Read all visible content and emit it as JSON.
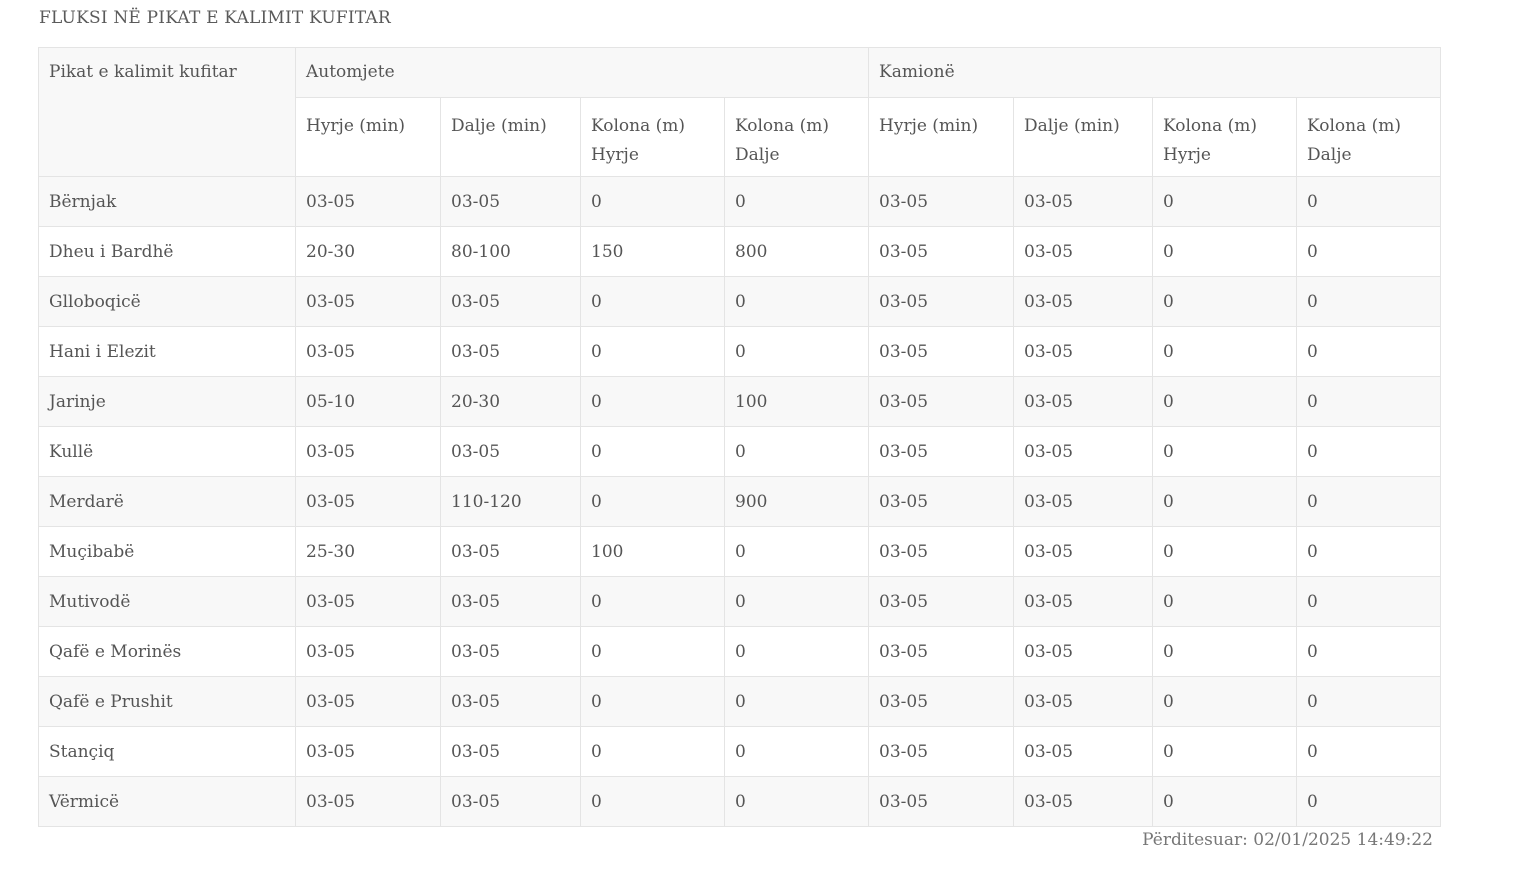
{
  "page_title": "FLUKSI NË PIKAT E KALIMIT KUFITAR",
  "table": {
    "point_header": "Pikat e kalimit kufitar",
    "group_headers": [
      "Automjete",
      "Kamionë"
    ],
    "sub_headers": [
      "Hyrje (min)",
      "Dalje (min)",
      "Kolona (m) Hyrje",
      "Kolona (m) Dalje",
      "Hyrje (min)",
      "Dalje (min)",
      "Kolona (m) Hyrje",
      "Kolona (m) Dalje"
    ],
    "rows": [
      {
        "name": "Bërnjak",
        "values": [
          "03-05",
          "03-05",
          "0",
          "0",
          "03-05",
          "03-05",
          "0",
          "0"
        ]
      },
      {
        "name": "Dheu i Bardhë",
        "values": [
          "20-30",
          "80-100",
          "150",
          "800",
          "03-05",
          "03-05",
          "0",
          "0"
        ]
      },
      {
        "name": "Glloboqicë",
        "values": [
          "03-05",
          "03-05",
          "0",
          "0",
          "03-05",
          "03-05",
          "0",
          "0"
        ]
      },
      {
        "name": "Hani i Elezit",
        "values": [
          "03-05",
          "03-05",
          "0",
          "0",
          "03-05",
          "03-05",
          "0",
          "0"
        ]
      },
      {
        "name": "Jarinje",
        "values": [
          "05-10",
          "20-30",
          "0",
          "100",
          "03-05",
          "03-05",
          "0",
          "0"
        ]
      },
      {
        "name": "Kullë",
        "values": [
          "03-05",
          "03-05",
          "0",
          "0",
          "03-05",
          "03-05",
          "0",
          "0"
        ]
      },
      {
        "name": "Merdarë",
        "values": [
          "03-05",
          "110-120",
          "0",
          "900",
          "03-05",
          "03-05",
          "0",
          "0"
        ]
      },
      {
        "name": "Muçibabë",
        "values": [
          "25-30",
          "03-05",
          "100",
          "0",
          "03-05",
          "03-05",
          "0",
          "0"
        ]
      },
      {
        "name": "Mutivodë",
        "values": [
          "03-05",
          "03-05",
          "0",
          "0",
          "03-05",
          "03-05",
          "0",
          "0"
        ]
      },
      {
        "name": "Qafë e Morinës",
        "values": [
          "03-05",
          "03-05",
          "0",
          "0",
          "03-05",
          "03-05",
          "0",
          "0"
        ]
      },
      {
        "name": "Qafë e Prushit",
        "values": [
          "03-05",
          "03-05",
          "0",
          "0",
          "03-05",
          "03-05",
          "0",
          "0"
        ]
      },
      {
        "name": "Stançiq",
        "values": [
          "03-05",
          "03-05",
          "0",
          "0",
          "03-05",
          "03-05",
          "0",
          "0"
        ]
      },
      {
        "name": "Vërmicë",
        "values": [
          "03-05",
          "03-05",
          "0",
          "0",
          "03-05",
          "03-05",
          "0",
          "0"
        ]
      }
    ]
  },
  "updated": "Përditesuar: 02/01/2025 14:49:22"
}
